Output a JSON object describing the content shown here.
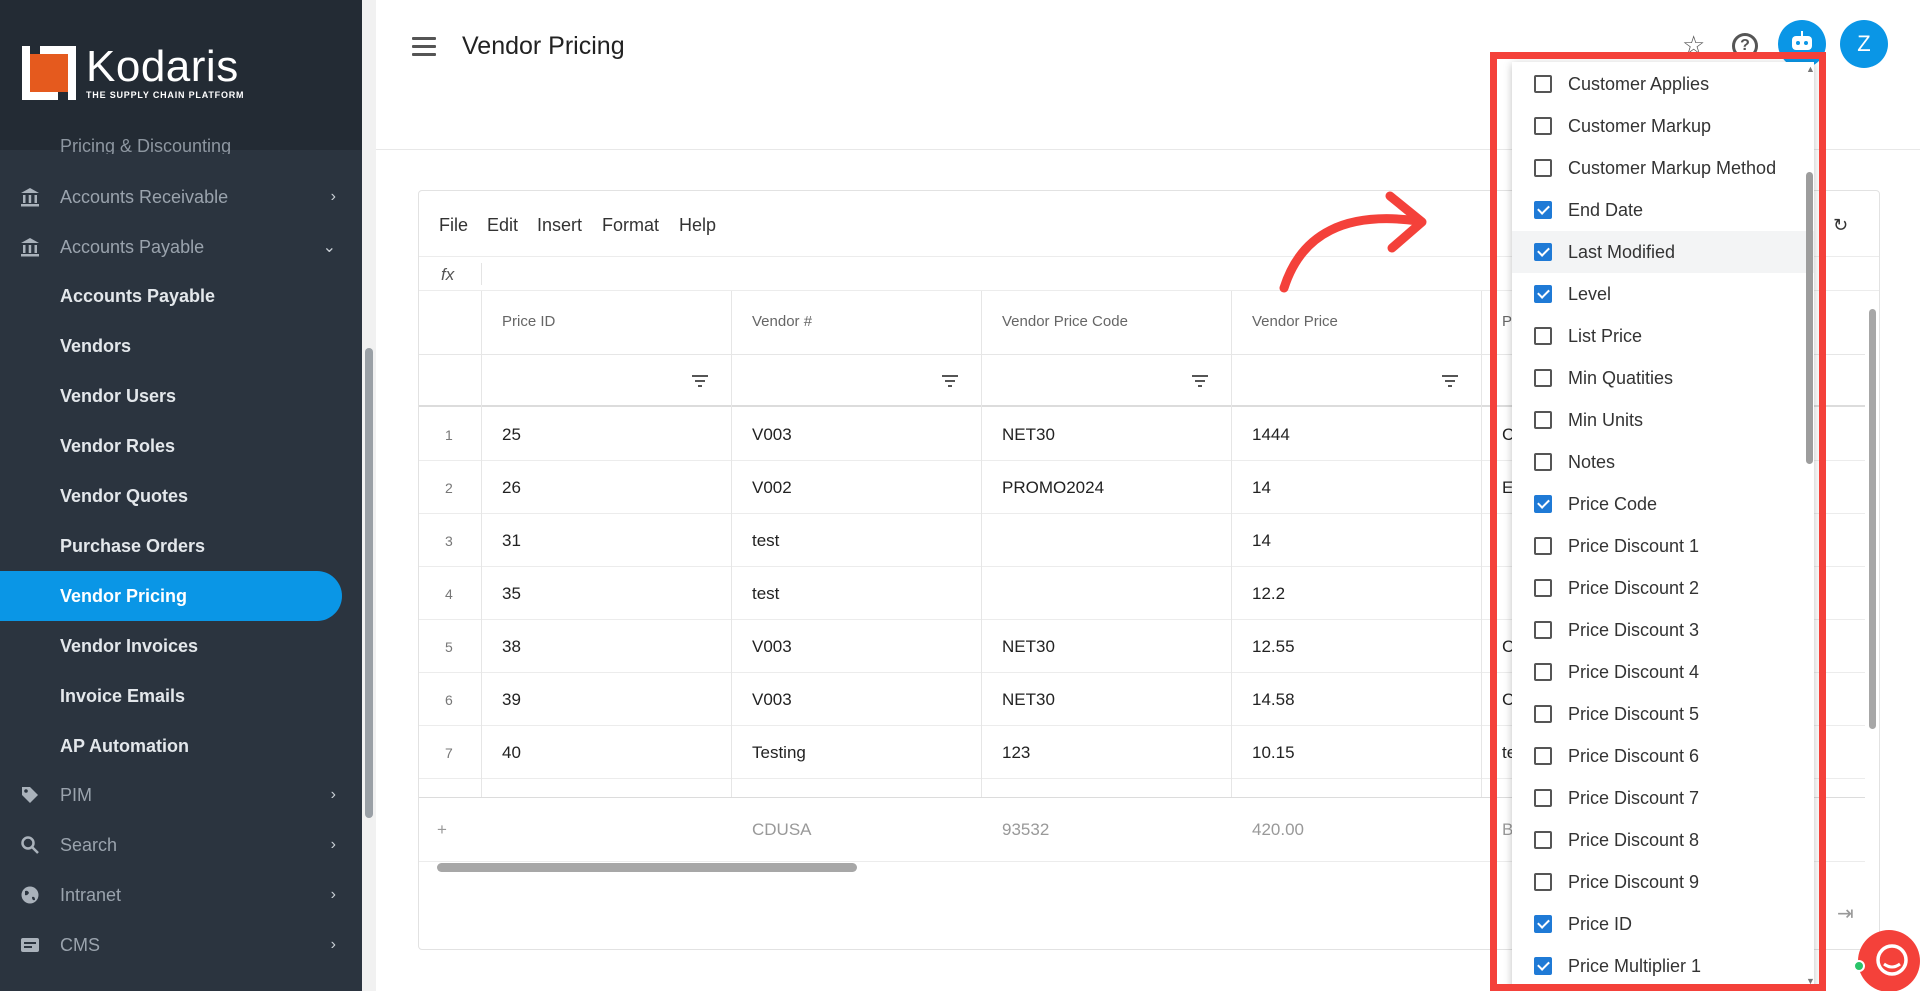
{
  "brand": {
    "name": "Kodaris",
    "tagline": "THE SUPPLY CHAIN PLATFORM",
    "accent": "#0a96e6",
    "logo_orange": "#e55a1e"
  },
  "sidebar": {
    "partial_item": "Pricing & Discounting",
    "items": [
      {
        "label": "Accounts Receivable",
        "icon": "bank-icon"
      },
      {
        "label": "Accounts Payable",
        "icon": "bank-icon"
      },
      {
        "label": "PIM",
        "icon": "tag-icon"
      },
      {
        "label": "Search",
        "icon": "search-icon"
      },
      {
        "label": "Intranet",
        "icon": "globe-icon"
      },
      {
        "label": "CMS",
        "icon": "cms-icon"
      }
    ],
    "sub_items": [
      "Accounts Payable",
      "Vendors",
      "Vendor Users",
      "Vendor Roles",
      "Vendor Quotes",
      "Purchase Orders",
      "Vendor Pricing",
      "Vendor Invoices",
      "Invoice Emails",
      "AP Automation"
    ],
    "active": "Vendor Pricing"
  },
  "header": {
    "title": "Vendor Pricing",
    "avatar_initial": "Z"
  },
  "menubar": [
    "File",
    "Edit",
    "Insert",
    "Format",
    "Help"
  ],
  "fx_label": "fx",
  "grid": {
    "columns": [
      "Price ID",
      "Vendor #",
      "Vendor Price Code",
      "Vendor Price",
      "P"
    ],
    "rows": [
      {
        "n": "1",
        "price_id": "25",
        "vendor": "V003",
        "code": "NET30",
        "price": "1444",
        "extra": "C"
      },
      {
        "n": "2",
        "price_id": "26",
        "vendor": "V002",
        "code": "PROMO2024",
        "price": "14",
        "extra": "E"
      },
      {
        "n": "3",
        "price_id": "31",
        "vendor": "test",
        "code": "",
        "price": "14",
        "extra": ""
      },
      {
        "n": "4",
        "price_id": "35",
        "vendor": "test",
        "code": "",
        "price": "12.2",
        "extra": ""
      },
      {
        "n": "5",
        "price_id": "38",
        "vendor": "V003",
        "code": "NET30",
        "price": "12.55",
        "extra": "C"
      },
      {
        "n": "6",
        "price_id": "39",
        "vendor": "V003",
        "code": "NET30",
        "price": "14.58",
        "extra": "C"
      },
      {
        "n": "7",
        "price_id": "40",
        "vendor": "Testing",
        "code": "123",
        "price": "10.15",
        "extra": "te"
      }
    ],
    "new_row": {
      "vendor": "CDUSA",
      "code": "93532",
      "price": "420.00",
      "extra": "B"
    }
  },
  "column_chooser": {
    "items": [
      {
        "label": "Customer Applies",
        "checked": false
      },
      {
        "label": "Customer Markup",
        "checked": false
      },
      {
        "label": "Customer Markup Method",
        "checked": false
      },
      {
        "label": "End Date",
        "checked": true
      },
      {
        "label": "Last Modified",
        "checked": true
      },
      {
        "label": "Level",
        "checked": true
      },
      {
        "label": "List Price",
        "checked": false
      },
      {
        "label": "Min Quatities",
        "checked": false
      },
      {
        "label": "Min Units",
        "checked": false
      },
      {
        "label": "Notes",
        "checked": false
      },
      {
        "label": "Price Code",
        "checked": true
      },
      {
        "label": "Price Discount 1",
        "checked": false
      },
      {
        "label": "Price Discount 2",
        "checked": false
      },
      {
        "label": "Price Discount 3",
        "checked": false
      },
      {
        "label": "Price Discount 4",
        "checked": false
      },
      {
        "label": "Price Discount 5",
        "checked": false
      },
      {
        "label": "Price Discount 6",
        "checked": false
      },
      {
        "label": "Price Discount 7",
        "checked": false
      },
      {
        "label": "Price Discount 8",
        "checked": false
      },
      {
        "label": "Price Discount 9",
        "checked": false
      },
      {
        "label": "Price ID",
        "checked": true
      },
      {
        "label": "Price Multiplier 1",
        "checked": true
      }
    ],
    "highlighted": "Last Modified",
    "highlight_color": "#f4413a"
  }
}
